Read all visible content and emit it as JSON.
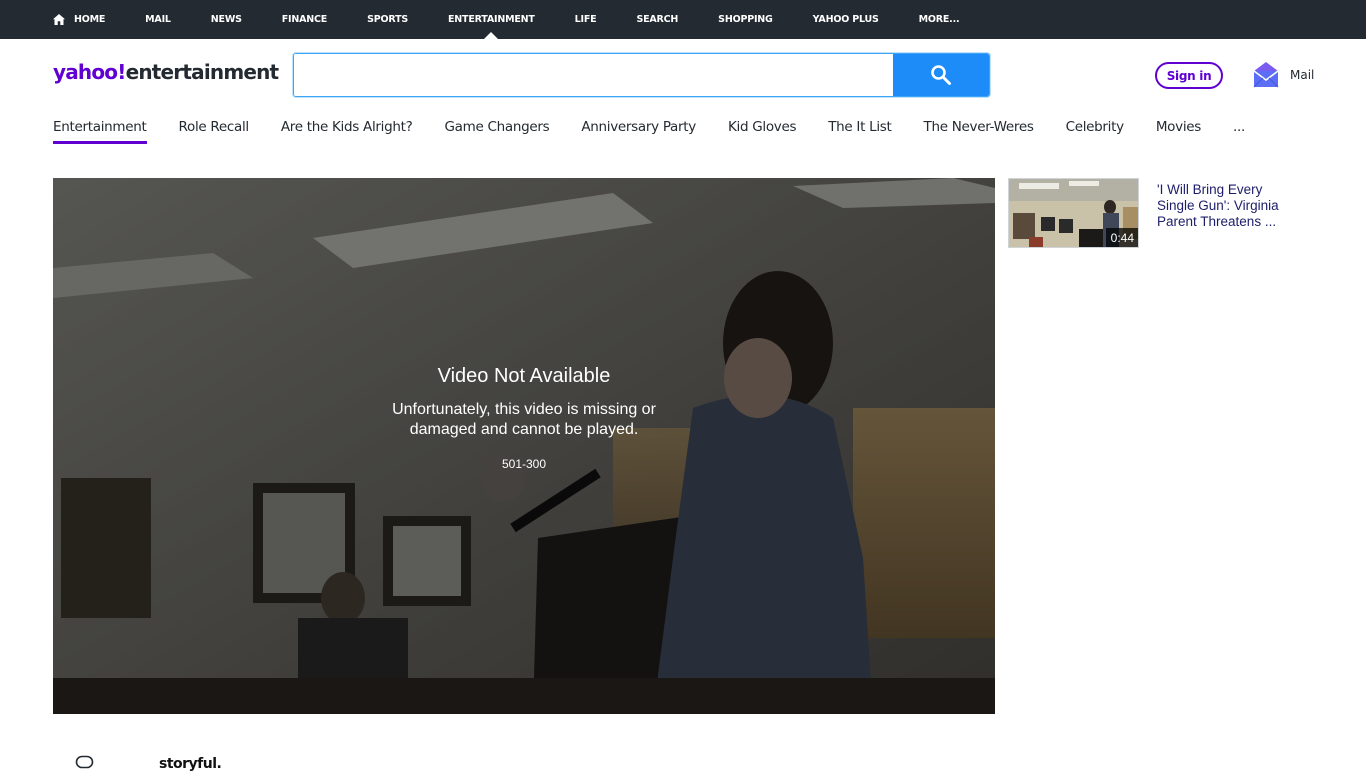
{
  "topnav": {
    "items": [
      {
        "label": "HOME"
      },
      {
        "label": "MAIL"
      },
      {
        "label": "NEWS"
      },
      {
        "label": "FINANCE"
      },
      {
        "label": "SPORTS"
      },
      {
        "label": "ENTERTAINMENT",
        "active": true
      },
      {
        "label": "LIFE"
      },
      {
        "label": "SEARCH"
      },
      {
        "label": "SHOPPING"
      },
      {
        "label": "YAHOO PLUS"
      },
      {
        "label": "MORE..."
      }
    ]
  },
  "header": {
    "logo_brand": "yahoo!",
    "logo_section": "entertainment",
    "search_value": "",
    "search_placeholder": "",
    "signin_label": "Sign in",
    "mail_label": "Mail"
  },
  "subnav": {
    "items": [
      {
        "label": "Entertainment",
        "active": true
      },
      {
        "label": "Role Recall"
      },
      {
        "label": "Are the Kids Alright?"
      },
      {
        "label": "Game Changers"
      },
      {
        "label": "Anniversary Party"
      },
      {
        "label": "Kid Gloves"
      },
      {
        "label": "The It List"
      },
      {
        "label": "The Never-Weres"
      },
      {
        "label": "Celebrity"
      },
      {
        "label": "Movies"
      },
      {
        "label": "..."
      }
    ]
  },
  "player": {
    "title": "Video Not Available",
    "body_line1": "Unfortunately, this video is missing or",
    "body_line2": "damaged and cannot be played.",
    "error_code": "501-300"
  },
  "playlist": {
    "items": [
      {
        "duration": "0:44",
        "title": "'I Will Bring Every Single Gun': Virginia Parent Threatens ..."
      }
    ]
  },
  "footer": {
    "provider": "storyful."
  },
  "colors": {
    "brand_purple": "#6001d2",
    "topbar_bg": "#232a31",
    "search_button": "#1d8bf8"
  }
}
